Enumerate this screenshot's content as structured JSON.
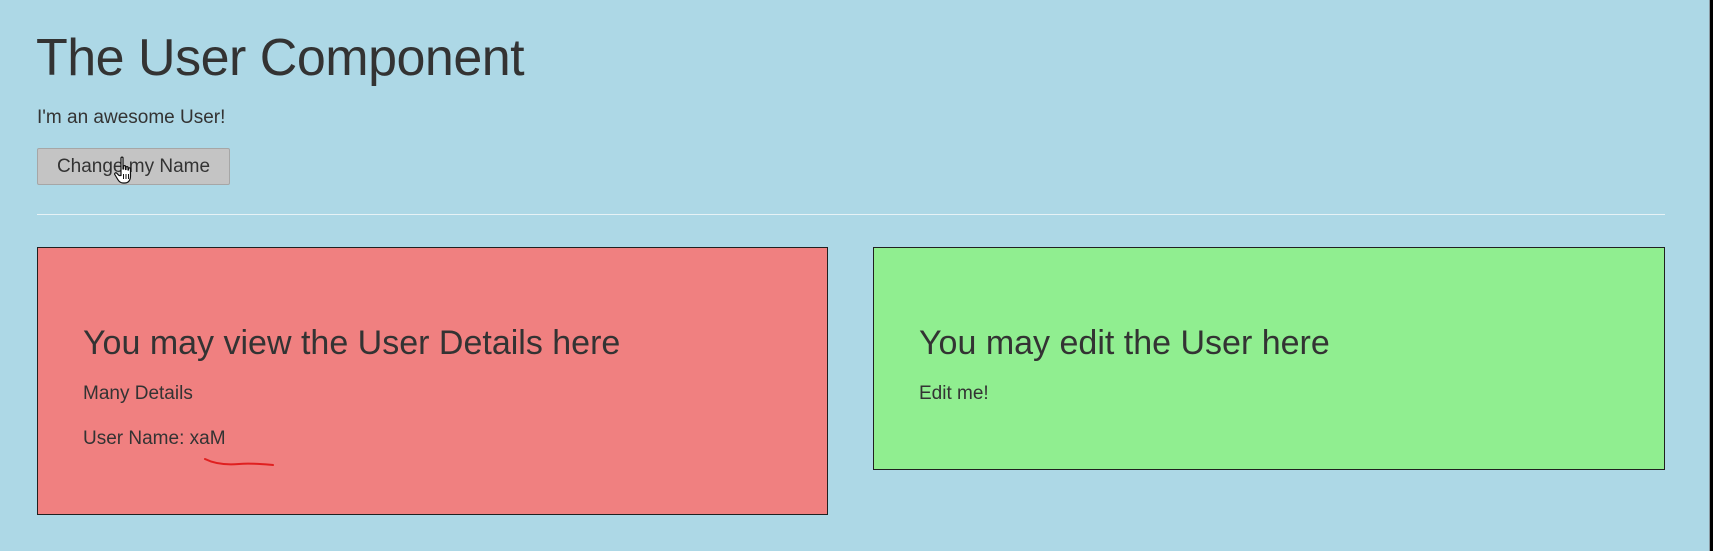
{
  "header": {
    "title": "The User Component",
    "subtitle": "I'm an awesome User!",
    "change_name_button": "Change my Name"
  },
  "detail_panel": {
    "title": "You may view the User Details here",
    "details_text": "Many Details",
    "user_name_label": "User Name:",
    "user_name_value": "xaM"
  },
  "edit_panel": {
    "title": "You may edit the User here",
    "text": "Edit me!"
  },
  "colors": {
    "background": "#add8e6",
    "detail_panel": "#f08080",
    "edit_panel": "#90ee90",
    "annotation": "#e02020"
  },
  "icons": {
    "cursor": "hand-pointer-icon"
  }
}
